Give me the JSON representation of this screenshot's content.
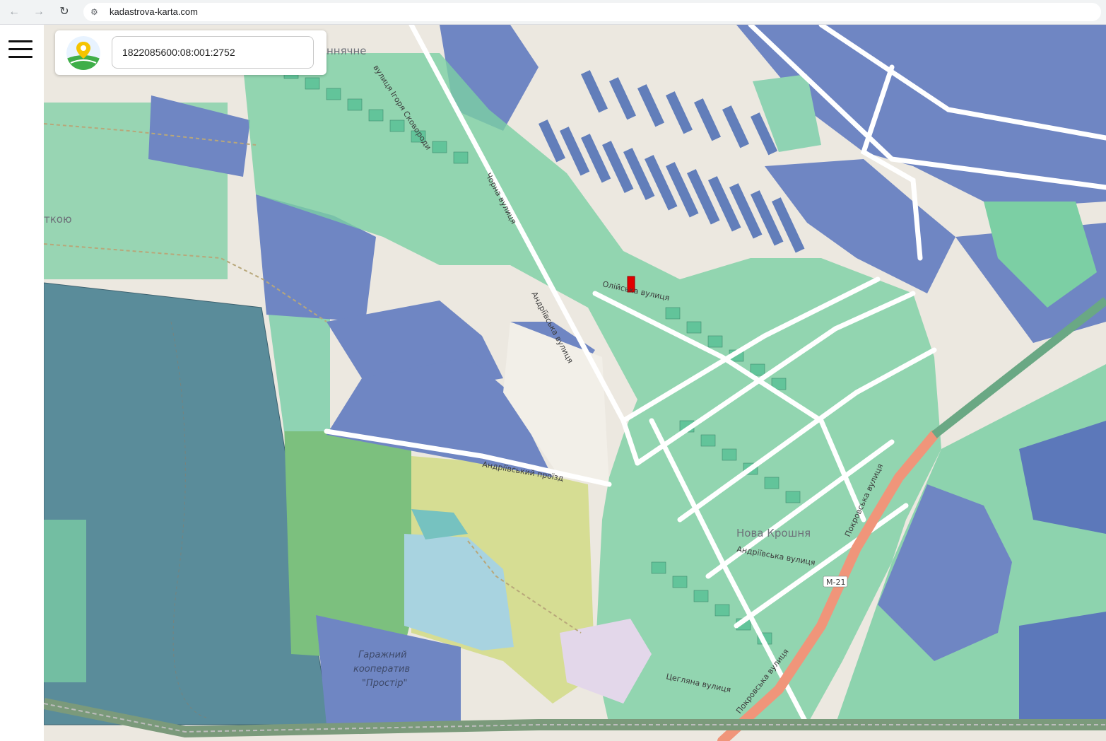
{
  "browser": {
    "url": "kadastrova-karta.com",
    "back_icon": "arrow-left-icon",
    "forward_icon": "arrow-right-icon",
    "reload_icon": "reload-icon",
    "site_info_icon": "tune-icon"
  },
  "app": {
    "menu_icon": "hamburger-menu-icon",
    "logo_icon": "map-pin-logo-icon",
    "search_value": "1822085600:08:001:2752"
  },
  "map": {
    "colors": {
      "background": "#ece8e0",
      "parcel_blue": "#6f86c3",
      "parcel_dark_blue": "#3f5fa8",
      "parcel_green": "#62c49a",
      "forest_parcel": "#5a8c9a",
      "park_green": "#7cc07e",
      "park_yellow": "#d6dd93",
      "water": "#a8d3e0",
      "highway": "#f0957a",
      "selected_parcel": "#e00000",
      "road": "#ffffff"
    },
    "labels": {
      "place_top": "ннячне",
      "place_left": "ткою",
      "place_nova_kroshnia": "Нова Крошня",
      "street_ihoria_skovorody": "вулиця Ігоря Сковороди",
      "street_andriivska_1": "Андріївська вулиця",
      "street_andriivska_2": "Андріївська вулиця",
      "street_andriivskyi_proizd": "Андріївський проїзд",
      "street_oliivska": "Олійська вулиця",
      "street_pokrovska_1": "Покровська вулиця",
      "street_pokrovska_2": "Покровська вулиця",
      "street_tsehlana": "Цегляна вулиця",
      "street_chorna": "Чорна вулиця",
      "road_m21": "М-21",
      "garage_line1": "Гаражний",
      "garage_line2": "кооператив",
      "garage_line3": "\"Простір\""
    }
  }
}
